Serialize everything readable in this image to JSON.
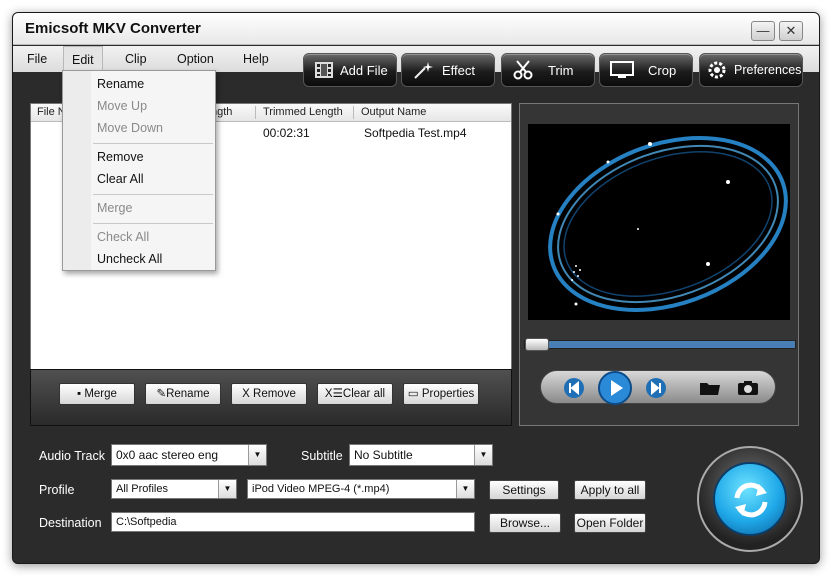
{
  "window": {
    "title": "Emicsoft MKV Converter",
    "minimize": "—",
    "close": "✕"
  },
  "menu": {
    "file": "File",
    "edit": "Edit",
    "clip": "Clip",
    "option": "Option",
    "help": "Help"
  },
  "toolbar": {
    "add_file": "Add File",
    "effect": "Effect",
    "trim": "Trim",
    "crop": "Crop",
    "preferences": "Preferences"
  },
  "file_list": {
    "headers": {
      "file": "File N",
      "length": "ngth",
      "trimmed": "Trimmed Length",
      "output": "Output Name"
    },
    "rows": [
      {
        "trimmed": "00:02:31",
        "output": "Softpedia Test.mp4"
      }
    ]
  },
  "list_buttons": {
    "merge": "Merge",
    "rename": "Rename",
    "remove": "X Remove",
    "clear": "Clear all",
    "properties": "Properties"
  },
  "edit_menu": {
    "rename": "Rename",
    "move_up": "Move Up",
    "move_down": "Move Down",
    "remove": "Remove",
    "clear_all": "Clear All",
    "merge": "Merge",
    "check_all": "Check All",
    "uncheck_all": "Uncheck All"
  },
  "settings": {
    "audio_track_label": "Audio Track",
    "audio_track_value": "0x0 aac stereo eng",
    "subtitle_label": "Subtitle",
    "subtitle_value": "No Subtitle",
    "profile_label": "Profile",
    "profile_category": "All Profiles",
    "profile_value": "iPod Video MPEG-4 (*.mp4)",
    "settings_button": "Settings",
    "apply_all_button": "Apply to all",
    "destination_label": "Destination",
    "destination_value": "C:\\Softpedia",
    "browse_button": "Browse...",
    "open_folder_button": "Open Folder"
  },
  "preview": {
    "progress": 0.0
  },
  "colors": {
    "window_bg": "#2b2b2b",
    "accent_blue": "#1fa8e8",
    "progress_blue": "#4a7fb5"
  }
}
